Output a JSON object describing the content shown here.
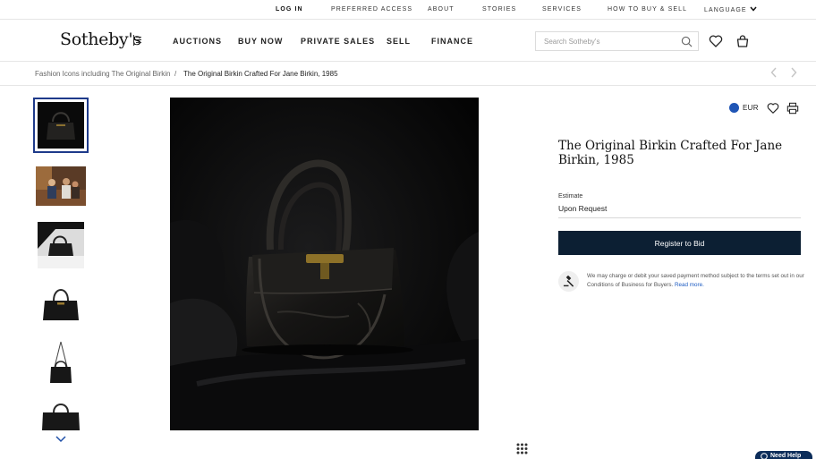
{
  "utility_nav": [
    "LOG IN",
    "PREFERRED ACCESS",
    "ABOUT",
    "STORIES",
    "SERVICES",
    "HOW TO BUY & SELL",
    "LANGUAGE"
  ],
  "brand": {
    "logo": "Sotheby's",
    "logo_mark_text": "EST 1744"
  },
  "main_nav": [
    "AUCTIONS",
    "BUY NOW",
    "PRIVATE SALES",
    "SELL",
    "FINANCE"
  ],
  "search": {
    "placeholder": "Search Sotheby's",
    "value": ""
  },
  "breadcrumb": {
    "parent": "Fashion Icons including The Original Birkin",
    "separator": "/",
    "current": "The Original Birkin Crafted For Jane Birkin, 1985"
  },
  "currency": "EUR",
  "lot": {
    "title": "The Original Birkin Crafted For Jane Birkin, 1985",
    "estimate_label": "Estimate",
    "estimate_value": "Upon Request"
  },
  "bid_button": "Register to Bid",
  "payment_note": {
    "text": "We may charge or debit your saved payment method subject to the terms set out in our Conditions of Business for Buyers.",
    "link": "Read more."
  },
  "help_tab": "Need Help",
  "thumbnails": [
    {
      "name": "thumb-bag-dark-background",
      "selected": true
    },
    {
      "name": "thumb-people-on-sofa",
      "selected": false
    },
    {
      "name": "thumb-bag-spotlight",
      "selected": false
    },
    {
      "name": "thumb-bag-front-white",
      "selected": false
    },
    {
      "name": "thumb-bag-strap-white",
      "selected": false
    },
    {
      "name": "thumb-bag-side-white",
      "selected": false
    }
  ],
  "colors": {
    "navy_button": "#0c1f33",
    "selected_thumb_border": "#1e3a8a",
    "link_blue": "#1d5bc2",
    "currency_dot": "#1f55b5"
  }
}
